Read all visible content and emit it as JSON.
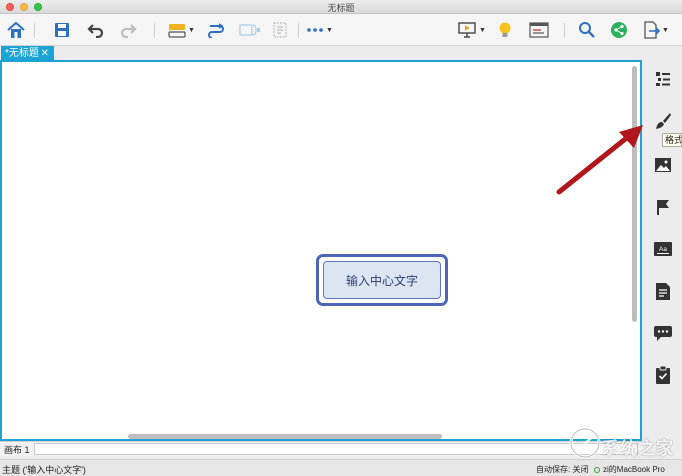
{
  "window": {
    "title": "无标题"
  },
  "toolbar": {
    "items": [
      "home",
      "save",
      "undo",
      "redo",
      "insert-topic",
      "relationship",
      "summary",
      "boundary",
      "more",
      "presentation",
      "idea",
      "outline",
      "search",
      "share",
      "export"
    ]
  },
  "tab": {
    "label": "*无标题",
    "close_glyph": "✕"
  },
  "canvas": {
    "central_topic": "输入中心文字"
  },
  "sidebar": {
    "tooltip": "格式",
    "items": [
      "outline-panel",
      "format-panel",
      "image-panel",
      "marker-panel",
      "style-panel",
      "notes-panel",
      "comment-panel",
      "task-panel"
    ]
  },
  "sheet": {
    "label": "画布 1"
  },
  "status": {
    "topic": "主题 ('输入中心文字')",
    "autosave": "自动保存: 关闭",
    "device": "zi的MacBook Pro"
  },
  "watermark": {
    "text": "系统之家"
  },
  "colors": {
    "accent": "#1aa3d4",
    "topic_border": "#4d66b8",
    "topic_fill": "#dce6f3",
    "arrow": "#b0161b"
  }
}
